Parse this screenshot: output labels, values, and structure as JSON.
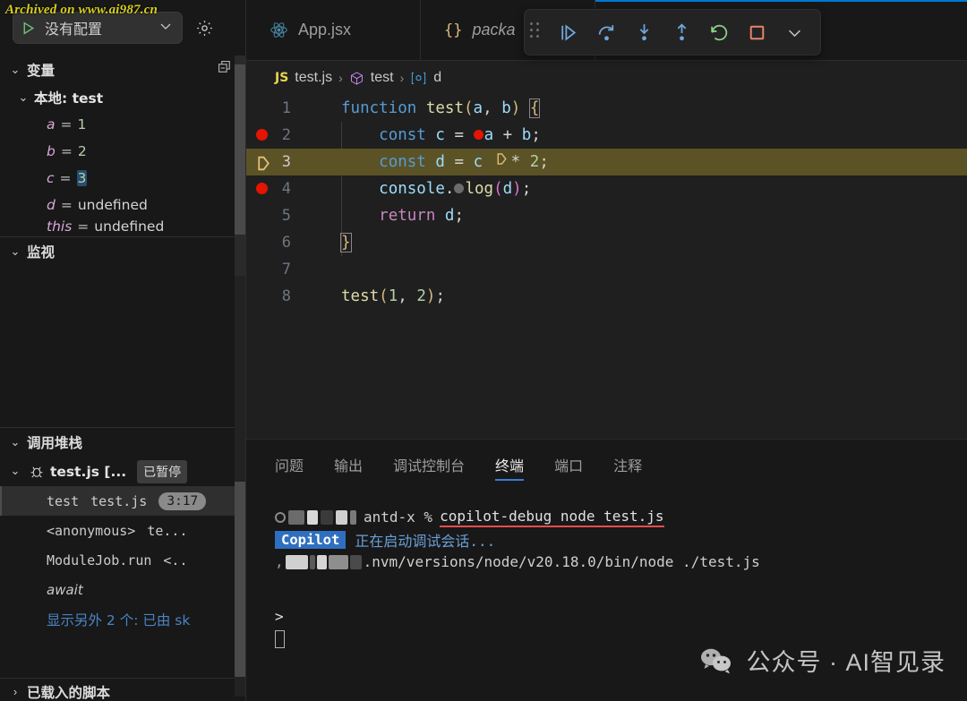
{
  "watermarks": {
    "top": "Archived on www.ai987.cn",
    "bottom": "公众号 · AI智见录"
  },
  "sidebar": {
    "run_config": {
      "play_icon": "play-icon",
      "label": "没有配置",
      "chevron": "chevron-down-icon",
      "settings_icon": "gear-icon"
    },
    "variables": {
      "title": "变量",
      "twisty": "⌄",
      "collapse_all_icon": "collapse-all-icon",
      "scope_label": "本地: test",
      "rows": [
        {
          "name": "a",
          "eq": "=",
          "value": "1",
          "kind": "num",
          "highlight": false
        },
        {
          "name": "b",
          "eq": "=",
          "value": "2",
          "kind": "num",
          "highlight": false
        },
        {
          "name": "c",
          "eq": "=",
          "value": "3",
          "kind": "num",
          "highlight": true
        },
        {
          "name": "d",
          "eq": "=",
          "value": "undefined",
          "kind": "undef",
          "highlight": false
        },
        {
          "name": "this",
          "eq": "=",
          "value": "undefined",
          "kind": "undef",
          "highlight": false
        }
      ]
    },
    "watch": {
      "title": "监视",
      "twisty": "⌄"
    },
    "callstack": {
      "title": "调用堆栈",
      "twisty": "⌄",
      "session": {
        "bug_icon": "bug-icon",
        "label": "test.js [...",
        "badge": "已暂停"
      },
      "frames": [
        {
          "fn": "test",
          "file": "test.js",
          "line": "3:17",
          "selected": true
        },
        {
          "fn": "<anonymous>",
          "file": "te...",
          "line": "",
          "selected": false
        },
        {
          "fn": "ModuleJob.run",
          "file": "<..",
          "line": "",
          "selected": false
        }
      ],
      "await_label": "await",
      "more_label": "显示另外 2 个: 已由 sk"
    },
    "loaded_scripts": {
      "title": "已载入的脚本",
      "twisty": "›"
    }
  },
  "tabs": [
    {
      "icon": "react-icon",
      "label": "App.jsx",
      "italic": false
    },
    {
      "icon": "json-icon",
      "label": "packa",
      "italic": true
    }
  ],
  "debug_toolbar": {
    "grip": "drag-grip-icon",
    "buttons": [
      {
        "name": "continue-button",
        "icon": "continue-icon",
        "color": "#6fa8dc"
      },
      {
        "name": "step-over-button",
        "icon": "step-over-icon",
        "color": "#6fa8dc"
      },
      {
        "name": "step-into-button",
        "icon": "step-into-icon",
        "color": "#6fa8dc"
      },
      {
        "name": "step-out-button",
        "icon": "step-out-icon",
        "color": "#6fa8dc"
      },
      {
        "name": "restart-button",
        "icon": "restart-icon",
        "color": "#89d185"
      },
      {
        "name": "stop-button",
        "icon": "stop-icon",
        "color": "#e8836b"
      },
      {
        "name": "more-button",
        "icon": "chevron-down-icon",
        "color": "#c5c5c5"
      }
    ]
  },
  "breadcrumb": {
    "file_badge": "JS",
    "file": "test.js",
    "sep": "›",
    "symbol_icon": "cube-icon",
    "symbol": "test",
    "var_icon": "variable-icon",
    "variable": "d"
  },
  "editor": {
    "lines": [
      {
        "n": "1",
        "breakpoint": false,
        "arrow": false,
        "highlight": false
      },
      {
        "n": "2",
        "breakpoint": true,
        "arrow": false,
        "highlight": false
      },
      {
        "n": "3",
        "breakpoint": false,
        "arrow": true,
        "highlight": true
      },
      {
        "n": "4",
        "breakpoint": true,
        "arrow": false,
        "highlight": false
      },
      {
        "n": "5",
        "breakpoint": false,
        "arrow": false,
        "highlight": false
      },
      {
        "n": "6",
        "breakpoint": false,
        "arrow": false,
        "highlight": false
      },
      {
        "n": "7",
        "breakpoint": false,
        "arrow": false,
        "highlight": false
      },
      {
        "n": "8",
        "breakpoint": false,
        "arrow": false,
        "highlight": false
      }
    ],
    "source": [
      "function test(a, b) {",
      "    const c = a + b;",
      "    const d = c * 2;",
      "    console.log(d);",
      "    return d;",
      "}",
      "",
      "test(1, 2);"
    ]
  },
  "panel": {
    "tabs": [
      {
        "label": "问题",
        "active": false
      },
      {
        "label": "输出",
        "active": false
      },
      {
        "label": "调试控制台",
        "active": false
      },
      {
        "label": "终端",
        "active": true
      },
      {
        "label": "端口",
        "active": false
      },
      {
        "label": "注释",
        "active": false
      }
    ],
    "terminal": {
      "prompt_prefix": "antd-x %",
      "command": "copilot-debug node test.js",
      "copilot_badge": "Copilot",
      "copilot_message": "正在启动调试会话...",
      "node_path": ".nvm/versions/node/v20.18.0/bin/node ./test.js",
      "prompt_symbol": ">"
    }
  },
  "colors": {
    "accent": "#0078d4",
    "breakpoint": "#e51400",
    "current_line": "#5b5226",
    "error_underline": "#f14c4c",
    "copilot_blue": "#2f6fc0"
  }
}
